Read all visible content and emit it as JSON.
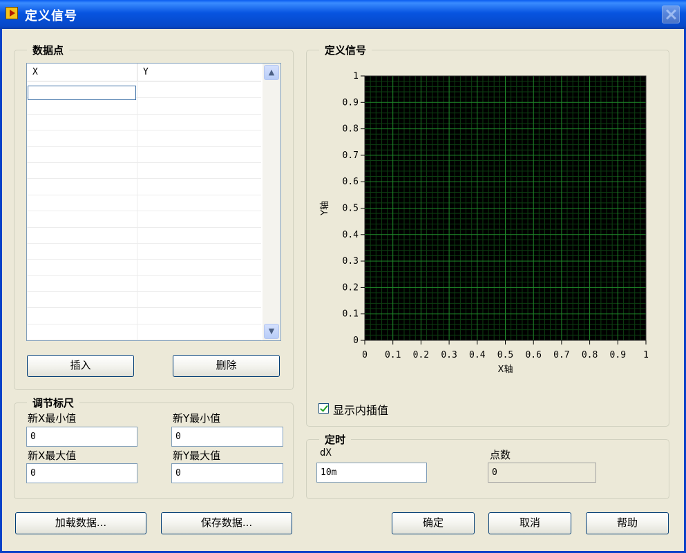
{
  "window": {
    "title": "定义信号"
  },
  "data_points": {
    "group_title": "数据点",
    "columns": [
      "X",
      "Y"
    ],
    "insert_label": "插入",
    "delete_label": "删除"
  },
  "scale": {
    "group_title": "调节标尺",
    "new_x_min_label": "新X最小值",
    "new_x_min_value": "0",
    "new_y_min_label": "新Y最小值",
    "new_y_min_value": "0",
    "new_x_max_label": "新X最大值",
    "new_x_max_value": "0",
    "new_y_max_label": "新Y最大值",
    "new_y_max_value": "0"
  },
  "signal": {
    "group_title": "定义信号",
    "show_interp_label": "显示内插值",
    "show_interp_checked": true
  },
  "timing": {
    "group_title": "定时",
    "dx_label": "dX",
    "dx_value": "10m",
    "points_label": "点数",
    "points_value": "0"
  },
  "footer": {
    "load_label": "加载数据...",
    "save_label": "保存数据...",
    "ok_label": "确定",
    "cancel_label": "取消",
    "help_label": "帮助"
  },
  "chart_data": {
    "type": "line",
    "xlabel": "X轴",
    "ylabel": "Y轴",
    "xlim": [
      0,
      1
    ],
    "ylim": [
      0,
      1
    ],
    "xticks": [
      "0",
      "0.1",
      "0.2",
      "0.3",
      "0.4",
      "0.5",
      "0.6",
      "0.7",
      "0.8",
      "0.9",
      "1"
    ],
    "yticks": [
      "0",
      "0.1",
      "0.2",
      "0.3",
      "0.4",
      "0.5",
      "0.6",
      "0.7",
      "0.8",
      "0.9",
      "1"
    ],
    "grid": true,
    "series": [],
    "colors": {
      "background": "#000000",
      "major_grid": "#1f8a2a",
      "minor_grid": "#0d3f12"
    }
  }
}
